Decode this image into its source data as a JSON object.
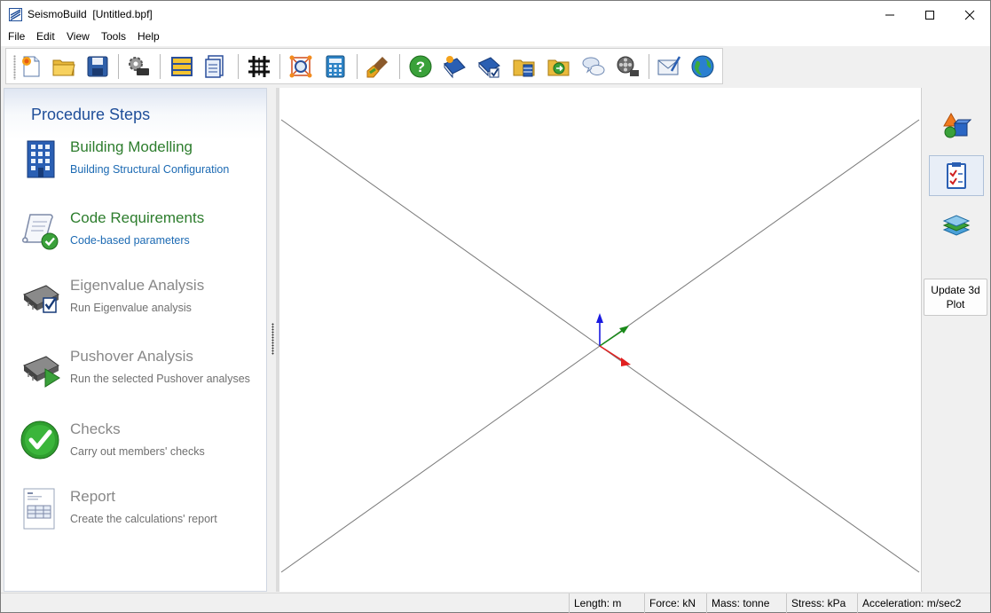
{
  "window": {
    "app_name": "SeismoBuild",
    "document": "[Untitled.bpf]"
  },
  "menu": [
    "File",
    "Edit",
    "View",
    "Tools",
    "Help"
  ],
  "toolbar": {
    "buttons": [
      "new-file-icon",
      "open-folder-icon",
      "save-icon",
      "settings-gears-icon",
      "frame-icon",
      "document-list-icon",
      "grid-structure-icon",
      "search-nodes-icon",
      "calculator-icon",
      "brush-icon",
      "help-icon",
      "book-icon",
      "manual-check-icon",
      "folder-building-icon",
      "folder-export-icon",
      "chat-icon",
      "video-reel-icon",
      "email-icon",
      "globe-icon"
    ]
  },
  "left_panel": {
    "title": "Procedure Steps",
    "steps": [
      {
        "title": "Building Modelling",
        "subtitle": "Building Structural Configuration",
        "icon": "building-icon",
        "state": "active"
      },
      {
        "title": "Code Requirements",
        "subtitle": "Code-based parameters",
        "icon": "code-scroll-check-icon",
        "state": "active"
      },
      {
        "title": "Eigenvalue Analysis",
        "subtitle": "Run Eigenvalue analysis",
        "icon": "chip-check-icon",
        "state": "inactive"
      },
      {
        "title": "Pushover Analysis",
        "subtitle": "Run the selected Pushover analyses",
        "icon": "chip-play-icon",
        "state": "inactive"
      },
      {
        "title": "Checks",
        "subtitle": "Carry out members' checks",
        "icon": "green-check-icon",
        "state": "inactive"
      },
      {
        "title": "Report",
        "subtitle": "Create the calculations' report",
        "icon": "report-document-icon",
        "state": "inactive"
      }
    ]
  },
  "right_panel": {
    "buttons": [
      "shapes-3d-icon",
      "checklist-icon",
      "layers-icon"
    ],
    "selected": "checklist-icon",
    "update_button_label": "Update 3d Plot"
  },
  "statusbar": {
    "length": "Length: m",
    "force": "Force: kN",
    "mass": "Mass: tonne",
    "stress": "Stress: kPa",
    "acceleration": "Acceleration: m/sec2"
  },
  "colors": {
    "active_title": "#2d7d2d",
    "active_subtitle": "#1c6ab3",
    "inactive_text": "#888888",
    "panel_title": "#1f4e99",
    "axis_x": "#e02020",
    "axis_y": "#1a8a1a",
    "axis_z": "#1a1ae0"
  }
}
